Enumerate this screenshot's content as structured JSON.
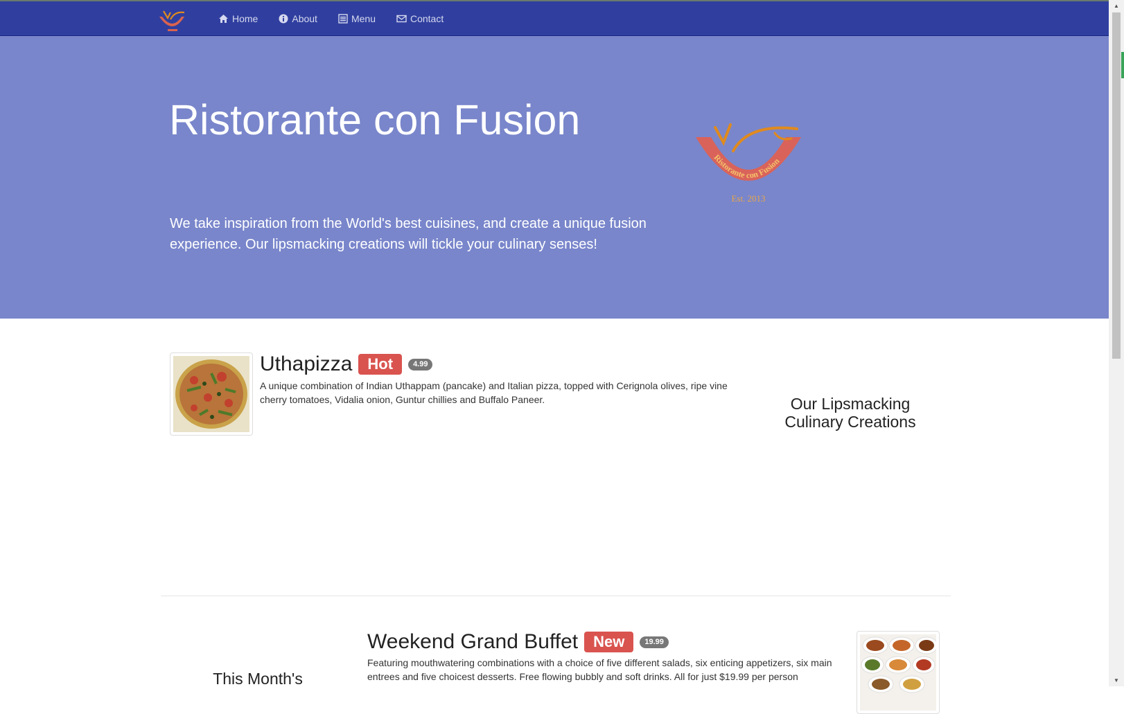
{
  "nav": {
    "brand_icon": "restaurant-logo",
    "items": [
      {
        "label": "Home",
        "icon": "home-icon"
      },
      {
        "label": "About",
        "icon": "info-icon"
      },
      {
        "label": "Menu",
        "icon": "list-icon"
      },
      {
        "label": "Contact",
        "icon": "envelope-icon"
      }
    ]
  },
  "hero": {
    "title": "Ristorante con Fusion",
    "text": "We take inspiration from the World's best cuisines, and create a unique fusion experience. Our lipsmacking creations will tickle your culinary senses!",
    "logo": {
      "arc_text": "Ristorante con Fusion",
      "est": "Est. 2013"
    }
  },
  "dishes": [
    {
      "name": "Uthapizza",
      "label": "Hot",
      "price": "4.99",
      "description": "A unique combination of Indian Uthappam (pancake) and Italian pizza, topped with Cerignola olives, ripe vine cherry tomatoes, Vidalia onion, Guntur chillies and Buffalo Paneer.",
      "side_heading": "Our Lipsmacking Culinary Creations"
    },
    {
      "name": "Weekend Grand Buffet",
      "label": "New",
      "price": "19.99",
      "description": "Featuring mouthwatering combinations with a choice of five different salads, six enticing appetizers, six main entrees and five choicest desserts. Free flowing bubbly and soft drinks. All for just $19.99 per person",
      "side_heading": "This Month's"
    }
  ],
  "colors": {
    "navbar": "#303f9f",
    "jumbotron": "#7986cb",
    "label_danger": "#d9534f",
    "badge": "#777777"
  }
}
